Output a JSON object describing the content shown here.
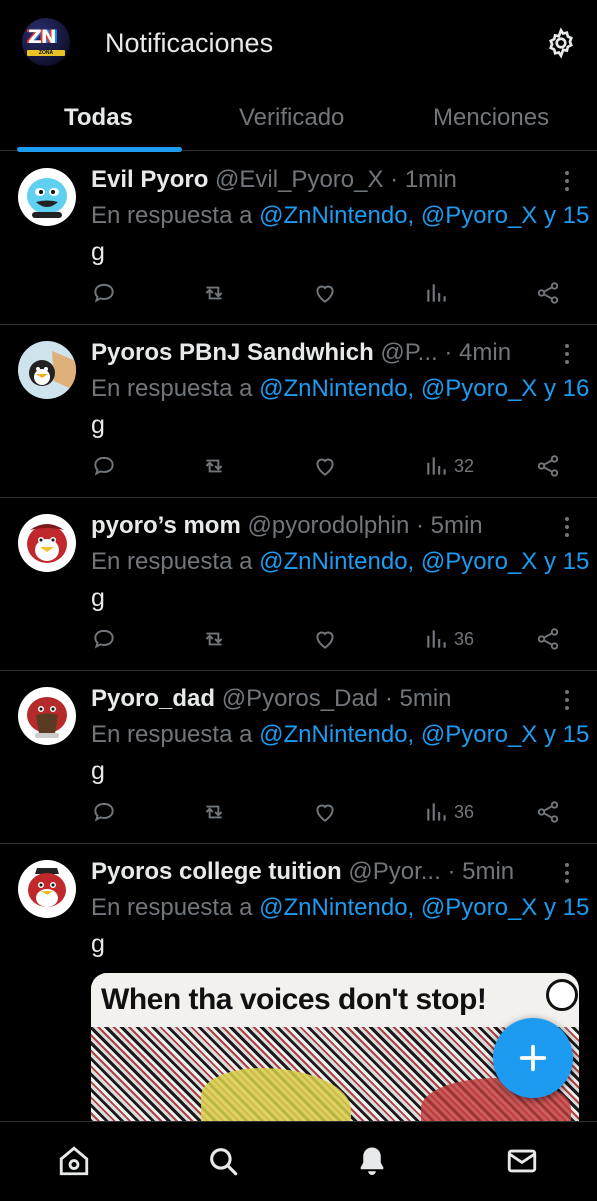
{
  "header": {
    "logo_text": "ZN",
    "logo_subtext": "ZONA NINTENDO",
    "title": "Notificaciones",
    "settings_icon": "gear-icon"
  },
  "tabs": [
    {
      "label": "Todas",
      "active": true
    },
    {
      "label": "Verificado",
      "active": false
    },
    {
      "label": "Menciones",
      "active": false
    }
  ],
  "posts": [
    {
      "name": "Evil Pyoro",
      "handle": "@Evil_Pyoro_X",
      "time": "· 1min",
      "reply_prefix": "En respuesta a ",
      "reply_mentions": "@ZnNintendo, @Pyoro_X y 15",
      "body": "g",
      "views": ""
    },
    {
      "name": "Pyoros PBnJ Sandwhich",
      "handle": "@P...",
      "time": "· 4min",
      "reply_prefix": "En respuesta a ",
      "reply_mentions": "@ZnNintendo, @Pyoro_X y 16",
      "body": "g",
      "views": "32"
    },
    {
      "name": "pyoro’s mom",
      "handle": "@pyorodolphin",
      "time": "· 5min",
      "reply_prefix": "En respuesta a ",
      "reply_mentions": "@ZnNintendo, @Pyoro_X y 15",
      "body": "g",
      "views": "36"
    },
    {
      "name": "Pyoro_dad",
      "handle": "@Pyoros_Dad",
      "time": "· 5min",
      "reply_prefix": "En respuesta a ",
      "reply_mentions": "@ZnNintendo, @Pyoro_X y 15",
      "body": "g",
      "views": "36"
    },
    {
      "name": "Pyoros college tuition",
      "handle": "@Pyor...",
      "time": "· 5min",
      "reply_prefix": "En respuesta a ",
      "reply_mentions": "@ZnNintendo, @Pyoro_X y 15",
      "body": "g",
      "media_caption": "When tha voices don't stop!"
    }
  ],
  "colors": {
    "accent": "#1d9bf0",
    "background": "#000000",
    "muted_text": "#71767b",
    "primary_text": "#e7e9ea"
  },
  "icons": {
    "reply": "reply-icon",
    "repost": "repost-icon",
    "like": "heart-icon",
    "views": "views-icon",
    "share": "share-icon",
    "more": "more-vertical-icon",
    "compose": "plus-icon",
    "nav": [
      "home-icon",
      "search-icon",
      "bell-icon",
      "mail-icon"
    ]
  }
}
